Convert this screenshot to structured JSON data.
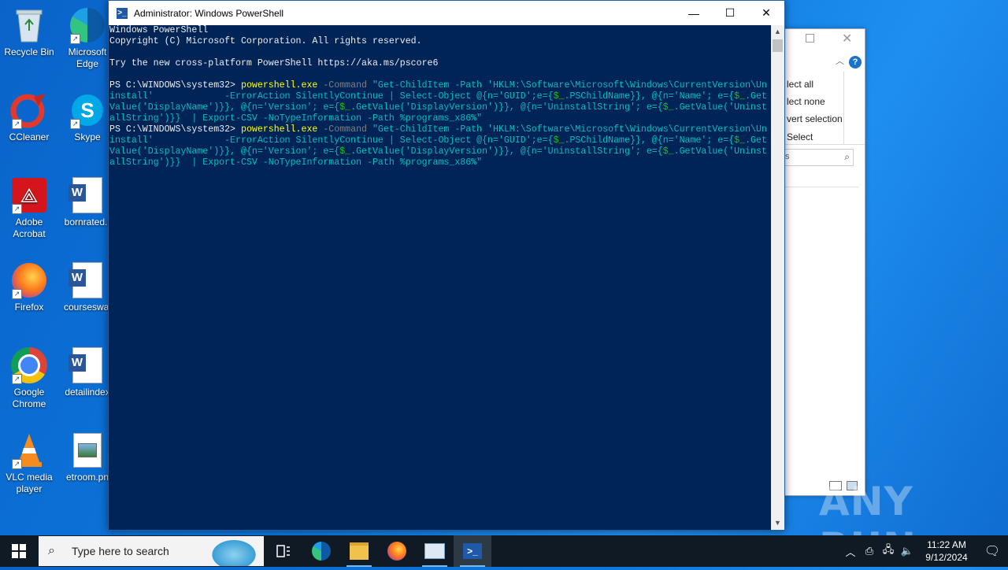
{
  "desktop": {
    "icons_col1": [
      {
        "name": "recycle-bin",
        "label": "Recycle Bin"
      },
      {
        "name": "ccleaner",
        "label": "CCleaner"
      },
      {
        "name": "adobe-acrobat",
        "label": "Adobe Acrobat"
      },
      {
        "name": "firefox",
        "label": "Firefox"
      },
      {
        "name": "google-chrome",
        "label": "Google Chrome"
      },
      {
        "name": "vlc-media-player",
        "label": "VLC media player"
      }
    ],
    "icons_col2": [
      {
        "name": "microsoft-edge",
        "label": "Microsoft Edge"
      },
      {
        "name": "skype",
        "label": "Skype"
      },
      {
        "name": "bornrated",
        "label": "bornrated.r"
      },
      {
        "name": "courseswal",
        "label": "courseswal"
      },
      {
        "name": "detailindex",
        "label": "detailindex"
      },
      {
        "name": "etroom",
        "label": "etroom.pn"
      }
    ]
  },
  "bg_window": {
    "items": [
      "lect all",
      "lect none",
      "vert selection",
      "Select"
    ],
    "search_placeholder": "s"
  },
  "powershell": {
    "title": "Administrator: Windows PowerShell",
    "lines": {
      "l1": "Windows PowerShell",
      "l2": "Copyright (C) Microsoft Corporation. All rights reserved.",
      "l3": "Try the new cross-platform PowerShell https://aka.ms/pscore6",
      "prompt": "PS C:\\WINDOWS\\system32> ",
      "cmd": "powershell.exe",
      "param": " -Command ",
      "arg1": "\"Get-ChildItem -Path 'HKLM:\\Software\\Microsoft\\Windows\\CurrentVersion\\Un",
      "arg2": "install'             -ErrorAction SilentlyContinue | Select-Object @{n='GUID';e={",
      "var": "$_",
      "arg2b": ".PSChildName}}, @{n='Name'; e={",
      "arg2c": ".Get",
      "arg3a": "Value('DisplayName')}}, @{n='Version'; e={",
      "arg3b": ".GetValue('DisplayVersion')}}, @{n='UninstallString'; e={",
      "arg3c": ".GetValue('Uninst",
      "arg4": "allString')}}  | Export-CSV -NoTypeInformation -Path %programs_x86%\""
    }
  },
  "watermark": "ANY RUN",
  "taskbar": {
    "search_placeholder": "Type here to search",
    "time": "11:22 AM",
    "date": "9/12/2024"
  }
}
